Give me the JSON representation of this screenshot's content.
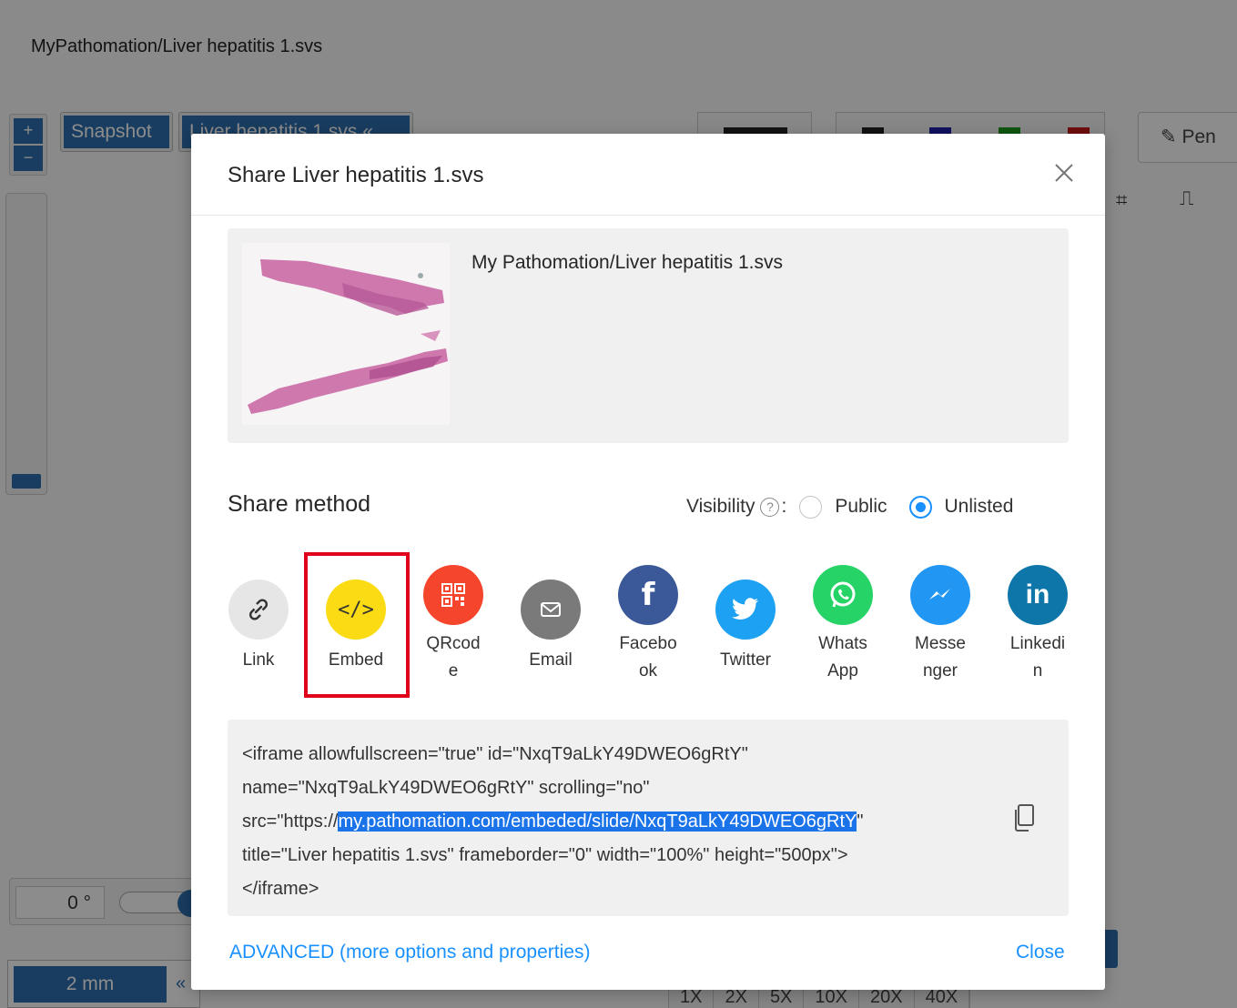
{
  "app": {
    "title": "MyPathomation/Liver hepatitis 1.svs",
    "zoom_in": "+",
    "zoom_out": "−",
    "snapshot_tab": "Snapshot",
    "slide_tab": "Liver hepatitis 1.svs",
    "collapse": "«",
    "pen_label": "Pen",
    "rotation_value": "0 °",
    "scale_label": "2 mm",
    "scale_toggle": "«",
    "zoom_levels": [
      "1X",
      "2X",
      "5X",
      "10X",
      "20X",
      "40X"
    ],
    "swatch_colors": [
      "#222222",
      "#222222",
      "#1f1fb0",
      "#1a9e1a",
      "#cc1a1a"
    ]
  },
  "modal": {
    "title": "Share Liver hepatitis 1.svs",
    "slide_path": "My Pathomation/Liver hepatitis 1.svs",
    "share_method_title": "Share method",
    "visibility_label": "Visibility",
    "visibility_colon": ":",
    "help_glyph": "?",
    "visibility_options": [
      "Public",
      "Unlisted"
    ],
    "visibility_selected": "Unlisted",
    "methods": [
      {
        "label": "Link",
        "icon": "link-icon",
        "color": "#e6e6e6"
      },
      {
        "label": "Embed",
        "icon": "code-icon",
        "color": "#fadb14"
      },
      {
        "label": "QRcode",
        "icon": "qrcode-icon",
        "color": "#f5462d"
      },
      {
        "label": "Email",
        "icon": "email-icon",
        "color": "#7a7a7a"
      },
      {
        "label": "Facebook",
        "icon": "facebook-icon",
        "color": "#3b5998"
      },
      {
        "label": "Twitter",
        "icon": "twitter-icon",
        "color": "#1da1f2"
      },
      {
        "label": "WhatsApp",
        "icon": "whatsapp-icon",
        "color": "#25d366"
      },
      {
        "label": "Messenger",
        "icon": "messenger-icon",
        "color": "#2196f3"
      },
      {
        "label": "Linkedin",
        "icon": "linkedin-icon",
        "color": "#0e76a8"
      }
    ],
    "method_labels_wrapped": [
      "Link",
      "Embed",
      "QRcod e",
      "Email",
      "Facebo ok",
      "Twitter",
      "Whats App",
      "Messe nger",
      "Linkedi n"
    ],
    "selected_method": "Embed",
    "embed_code": {
      "line1": "<iframe allowfullscreen=\"true\" id=\"NxqT9aLkY49DWEO6gRtY\"",
      "line2": "name=\"NxqT9aLkY49DWEO6gRtY\" scrolling=\"no\"",
      "line3_pre": "src=\"https://",
      "line3_highlight": "my.pathomation.com/embeded/slide/NxqT9aLkY49DWEO6gRtY",
      "line3_post": "\"",
      "line4": "title=\"Liver hepatitis 1.svs\" frameborder=\"0\" width=\"100%\" height=\"500px\">",
      "line5": "</iframe>"
    },
    "advanced_link": "ADVANCED (more options and properties)",
    "close_link": "Close"
  }
}
